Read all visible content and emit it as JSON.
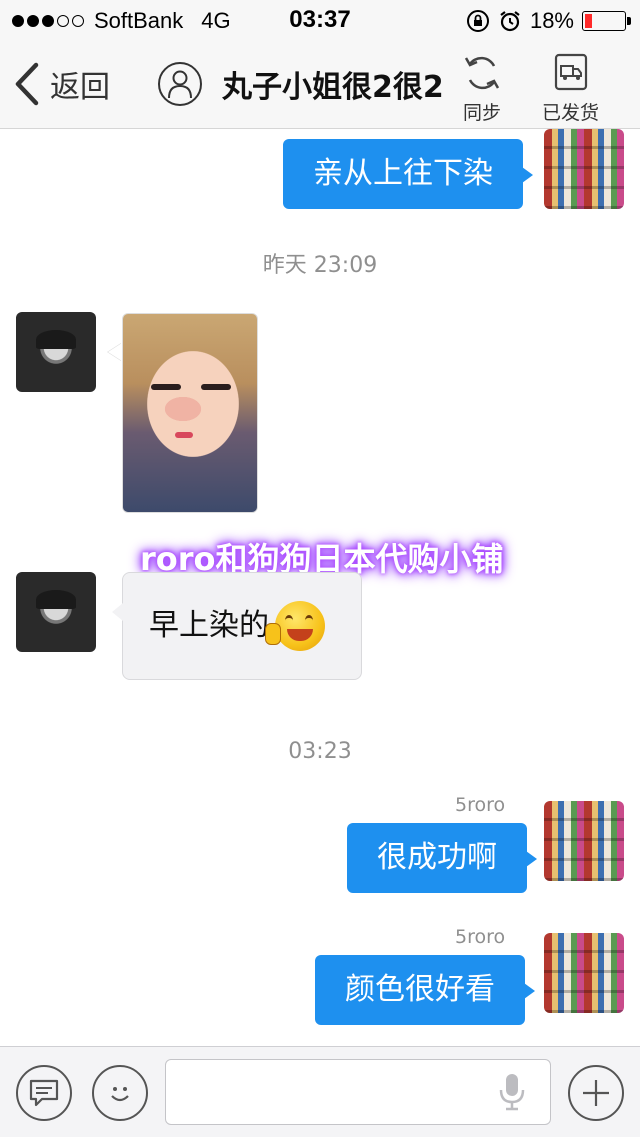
{
  "status_bar": {
    "carrier": "SoftBank",
    "network": "4G",
    "time": "03:37",
    "battery": "18%",
    "battery_level": 0.18,
    "signal_bars": 3,
    "signal_total": 5
  },
  "nav": {
    "back_label": "返回",
    "title": "丸子小姐很2很2",
    "sync_label": "同步",
    "shipped_label": "已发货"
  },
  "messages": [
    {
      "side": "right",
      "text": "亲从上往下染"
    },
    {
      "type": "timestamp",
      "text": "昨天 23:09"
    },
    {
      "side": "left",
      "type": "image"
    },
    {
      "side": "left",
      "text": "早上染的"
    },
    {
      "type": "timestamp",
      "text": "03:23"
    },
    {
      "side": "right",
      "sender": "5roro",
      "text": "很成功啊"
    },
    {
      "side": "right",
      "sender": "5roro",
      "text": "颜色很好看"
    }
  ],
  "watermark": "roro和狗狗日本代购小铺",
  "colors": {
    "outgoing_bubble": "#1e90ef",
    "incoming_bubble": "#f2f2f4",
    "battery_low": "#ff2a2a",
    "watermark_glow": "#b050ff"
  }
}
